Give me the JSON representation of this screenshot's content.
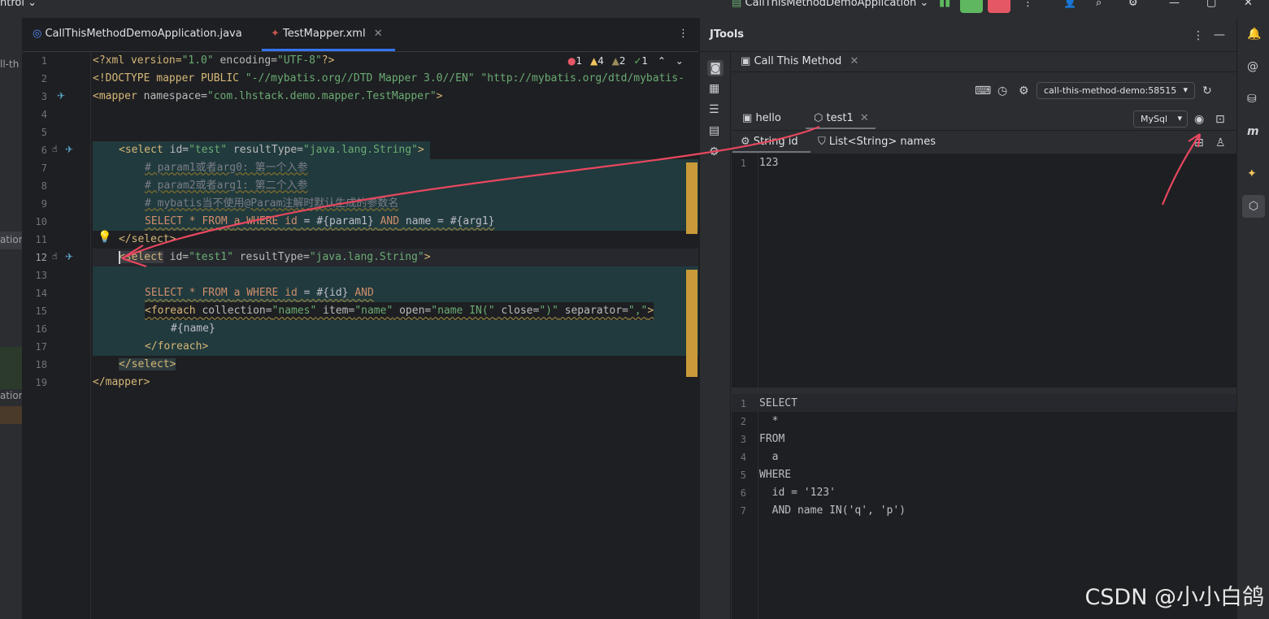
{
  "titlebar": {
    "project_fragment": "ntrol",
    "run_config": "CallThisMethodDemoApplication"
  },
  "left_strip": {
    "frag_top": "ll-th",
    "frag_mid1": "ation",
    "frag_mid2": "ation"
  },
  "editor": {
    "tabs": [
      {
        "label": "CallThisMethodDemoApplication.java",
        "active": false
      },
      {
        "label": "TestMapper.xml",
        "active": true
      }
    ],
    "inspections": {
      "errors": "1",
      "warnings": "4",
      "weak_warnings": "2",
      "ok": "1"
    },
    "lines": [
      {
        "n": "1"
      },
      {
        "n": "2"
      },
      {
        "n": "3"
      },
      {
        "n": "4"
      },
      {
        "n": "5"
      },
      {
        "n": "6"
      },
      {
        "n": "7"
      },
      {
        "n": "8"
      },
      {
        "n": "9"
      },
      {
        "n": "10"
      },
      {
        "n": "11"
      },
      {
        "n": "12"
      },
      {
        "n": "13"
      },
      {
        "n": "14"
      },
      {
        "n": "15"
      },
      {
        "n": "16"
      },
      {
        "n": "17"
      },
      {
        "n": "18"
      },
      {
        "n": "19"
      }
    ],
    "code": {
      "l1_a": "<?xml version=",
      "l1_b": "\"1.0\"",
      "l1_c": " encoding=",
      "l1_d": "\"UTF-8\"",
      "l1_e": "?>",
      "l2_a": "<!DOCTYPE mapper PUBLIC ",
      "l2_b": "\"-//mybatis.org//DTD Mapper 3.0//EN\"",
      "l2_c": " \"http://mybatis.org/dtd/mybatis-",
      "l3_a": "<mapper ",
      "l3_b": "namespace=",
      "l3_c": "\"com.lhstack.demo.mapper.TestMapper\"",
      "l3_d": ">",
      "l6_a": "<select ",
      "l6_b": "id=",
      "l6_c": "\"test\"",
      "l6_d": " resultType=",
      "l6_e": "\"java.lang.String\"",
      "l6_f": ">",
      "l7": "# param1或者arg0: 第一个入参",
      "l8": "# param2或者arg1: 第二个入参",
      "l9": "# mybatis当不使用@Param注解时默认生成的参数名",
      "l10_a": "SELECT * FROM ",
      "l10_b": "a",
      "l10_c": " WHERE ",
      "l10_d": "id",
      "l10_e": " = #{param1} ",
      "l10_f": "AND",
      "l10_g": " name = #{arg1}",
      "l11": "</select>",
      "l12_a": "<select",
      "l12_b": " id=",
      "l12_c": "\"test1\"",
      "l12_d": " resultType=",
      "l12_e": "\"java.lang.String\"",
      "l12_f": ">",
      "l14_a": "SELECT * FROM ",
      "l14_b": "a",
      "l14_c": " WHERE ",
      "l14_d": "id",
      "l14_e": " = #{id} ",
      "l14_f": "AND",
      "l15_a": "<foreach ",
      "l15_b": "collection=",
      "l15_c": "\"names\"",
      "l15_d": " item=",
      "l15_e": "\"name\"",
      "l15_f": " open=",
      "l15_g": "\"name IN(\"",
      "l15_h": " close=",
      "l15_i": "\")\"",
      "l15_j": " separator=",
      "l15_k": "\",\"",
      "l15_l": ">",
      "l16": "#{name}",
      "l17": "</foreach>",
      "l18": "</select>",
      "l19": "</mapper>"
    }
  },
  "jtools": {
    "title": "JTools",
    "tool_tab": "Call This Method",
    "process_select": "call-this-method-demo:58515",
    "method_tabs": [
      {
        "label": "hello",
        "active": false
      },
      {
        "label": "test1",
        "active": true
      }
    ],
    "dialect_select": "MySql",
    "param_tabs": [
      {
        "label": "String id",
        "active": true
      },
      {
        "label": "List<String> names",
        "active": false
      }
    ],
    "param_editor": {
      "lines": [
        {
          "n": "1",
          "text": "123"
        }
      ]
    },
    "sql_output": {
      "lines": [
        {
          "n": "1",
          "text": "SELECT"
        },
        {
          "n": "2",
          "text": "  *"
        },
        {
          "n": "3",
          "text": "FROM"
        },
        {
          "n": "4",
          "text": "  a"
        },
        {
          "n": "5",
          "text": "WHERE"
        },
        {
          "n": "6",
          "text": "  id = '123'"
        },
        {
          "n": "7",
          "text": "  AND name IN('q', 'p')"
        }
      ]
    }
  },
  "watermark": "CSDN @小小白鸽",
  "colors": {
    "accent": "#3574f0",
    "annotation_arrow": "#e8475f",
    "run_green": "#5fb85f",
    "stop_red": "#e55765"
  }
}
